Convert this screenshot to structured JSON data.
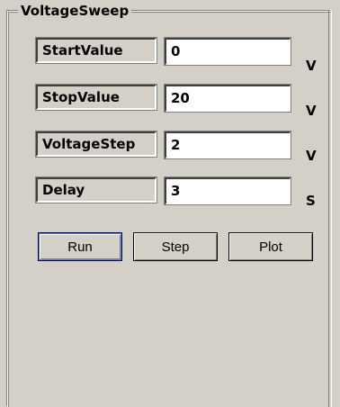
{
  "group": {
    "title": "VoltageSweep"
  },
  "rows": [
    {
      "label": "StartValue",
      "value": "0",
      "unit": "V"
    },
    {
      "label": "StopValue",
      "value": "20",
      "unit": "V"
    },
    {
      "label": "VoltageStep",
      "value": "2",
      "unit": "V"
    },
    {
      "label": "Delay",
      "value": "3",
      "unit": "S"
    }
  ],
  "buttons": {
    "run_label": "Run",
    "step_label": "Step",
    "plot_label": "Plot"
  }
}
